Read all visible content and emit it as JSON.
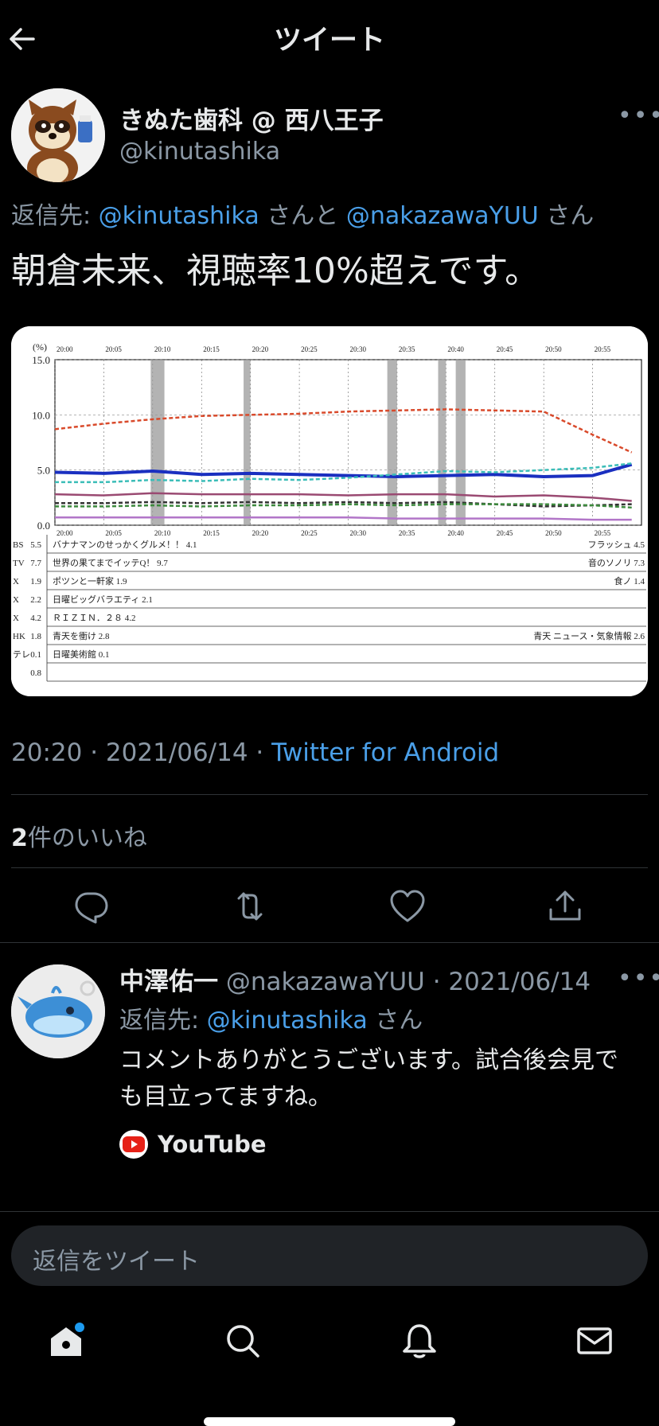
{
  "header": {
    "title": "ツイート"
  },
  "tweet": {
    "display_name": "きぬた歯科 @ 西八王子",
    "handle": "@kinutashika",
    "reply_prefix": "返信先: ",
    "reply_user1": "@kinutashika",
    "reply_mid": " さんと ",
    "reply_user2": "@nakazawaYUU",
    "reply_suffix": " さん",
    "text": "朝倉未来、視聴率10%超えです。",
    "time": "20:20 · 2021/06/14 · ",
    "client": "Twitter for Android",
    "likes_count": "2",
    "likes_label": "件のいいね"
  },
  "media": {
    "chart_data": {
      "type": "line",
      "ylabel": "(%)",
      "ylim": [
        0,
        15
      ],
      "y_ticks": [
        "15.0",
        "10.0",
        "5.0",
        "0.0"
      ],
      "x_ticks": [
        "20:00",
        "20:05",
        "20:10",
        "20:15",
        "20:20",
        "20:25",
        "20:30",
        "20:35",
        "20:40",
        "20:45",
        "20:50",
        "20:55"
      ],
      "x": [
        0,
        5,
        10,
        15,
        20,
        25,
        30,
        35,
        40,
        45,
        50,
        55,
        59
      ],
      "series": [
        {
          "color": "#d94a2b",
          "values": [
            8.7,
            9.2,
            9.6,
            9.9,
            10.0,
            10.1,
            10.3,
            10.4,
            10.5,
            10.4,
            10.3,
            8.2,
            6.6
          ]
        },
        {
          "color": "#1a2fc0",
          "values": [
            4.8,
            4.7,
            4.9,
            4.6,
            4.7,
            4.6,
            4.5,
            4.4,
            4.5,
            4.6,
            4.4,
            4.5,
            5.5
          ]
        },
        {
          "color": "#3bbdb8",
          "values": [
            3.9,
            3.9,
            4.1,
            4.0,
            4.2,
            4.1,
            4.3,
            4.6,
            4.9,
            4.8,
            5.0,
            5.2,
            5.6
          ]
        },
        {
          "color": "#9a4a72",
          "values": [
            2.8,
            2.7,
            2.9,
            2.8,
            2.8,
            2.8,
            2.7,
            2.8,
            2.8,
            2.6,
            2.7,
            2.5,
            2.2
          ]
        },
        {
          "color": "#333333",
          "values": [
            2.0,
            2.0,
            2.1,
            2.0,
            2.1,
            2.0,
            2.1,
            2.0,
            2.1,
            1.9,
            1.7,
            1.8,
            1.9
          ]
        },
        {
          "color": "#3d8a3d",
          "values": [
            1.7,
            1.7,
            1.8,
            1.7,
            1.8,
            1.8,
            1.9,
            1.8,
            1.9,
            1.9,
            1.9,
            1.8,
            1.6
          ]
        },
        {
          "color": "#b276c8",
          "values": [
            0.7,
            0.7,
            0.7,
            0.7,
            0.7,
            0.7,
            0.7,
            0.6,
            0.6,
            0.6,
            0.6,
            0.5,
            0.5
          ]
        }
      ],
      "legend_rows": [
        {
          "station": "BS",
          "value": "5.5",
          "program": "バナナマンのせっかくグルメ！！ 4.1",
          "tail": "フラッシュ 4.5"
        },
        {
          "station": "TV",
          "value": "7.7",
          "program": "世界の果てまでイッテQ！ 9.7",
          "tail": "音のソノリ 7.3"
        },
        {
          "station": "X",
          "value": "1.9",
          "program": "ポツンと一軒家 1.9",
          "tail": "食ノ 1.4"
        },
        {
          "station": "X",
          "value": "2.2",
          "program": "日曜ビッグバラエティ 2.1",
          "tail": ""
        },
        {
          "station": "X",
          "value": "4.2",
          "program": "ＲＩＺＩＮ．２８ 4.2",
          "tail": ""
        },
        {
          "station": "HK",
          "value": "1.8",
          "program": "青天を衝け 2.8",
          "tail": "青天 ニュース・気象情報 2.6"
        },
        {
          "station": "テレ",
          "value": "0.1",
          "program": "日曜美術館 0.1",
          "tail": ""
        },
        {
          "station": "",
          "value": "0.8",
          "program": "",
          "tail": ""
        }
      ]
    }
  },
  "reply": {
    "name": "中澤佑一",
    "handle_date": " @nakazawaYUU · 2021/06/14",
    "reply_prefix": "返信先: ",
    "reply_user": "@kinutashika",
    "reply_suffix": " さん",
    "text": "コメントありがとうございます。試合後会見でも目立ってますね。",
    "link_label": "YouTube"
  },
  "composer": {
    "placeholder": "返信をツイート"
  },
  "icons": {
    "back": "arrow-left-icon",
    "more": "more-horizontal-icon",
    "reply": "reply-icon",
    "retweet": "retweet-icon",
    "like": "heart-icon",
    "share": "share-icon",
    "home": "home-icon",
    "search": "search-icon",
    "notifications": "bell-icon",
    "messages": "mail-icon"
  },
  "more_label": "•••",
  "colors": {
    "link": "#4a9fe8",
    "accent": "#1d9bf0",
    "youtube": "#e62117"
  }
}
